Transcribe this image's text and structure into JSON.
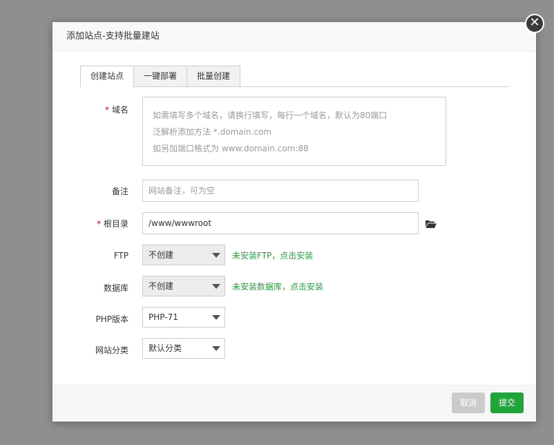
{
  "dialog": {
    "title": "添加站点-支持批量建站",
    "close_symbol": "✕"
  },
  "tabs": [
    {
      "label": "创建站点",
      "active": true
    },
    {
      "label": "一键部署",
      "active": false
    },
    {
      "label": "批量创建",
      "active": false
    }
  ],
  "form": {
    "domain": {
      "required_mark": "*",
      "label": "域名",
      "placeholder_lines": [
        "如需填写多个域名，请换行填写，每行一个域名，默认为80端口",
        "泛解析添加方法 *.domain.com",
        "如另加端口格式为 www.domain.com:88"
      ]
    },
    "remark": {
      "label": "备注",
      "placeholder": "网站备注，可为空"
    },
    "root": {
      "required_mark": "*",
      "label": "根目录",
      "value": "/www/wwwroot",
      "icon": "folder-open-icon"
    },
    "ftp": {
      "label": "FTP",
      "selected": "不创建",
      "hint": "未安装FTP，点击安装"
    },
    "database": {
      "label": "数据库",
      "selected": "不创建",
      "hint": "未安装数据库，点击安装"
    },
    "php": {
      "label": "PHP版本",
      "selected": "PHP-71"
    },
    "category": {
      "label": "网站分类",
      "selected": "默认分类"
    }
  },
  "footer": {
    "cancel_label": "取消",
    "submit_label": "提交"
  },
  "colors": {
    "accent": "#20a53a",
    "required": "#ee0000",
    "overlay": "#8f8f8f"
  }
}
